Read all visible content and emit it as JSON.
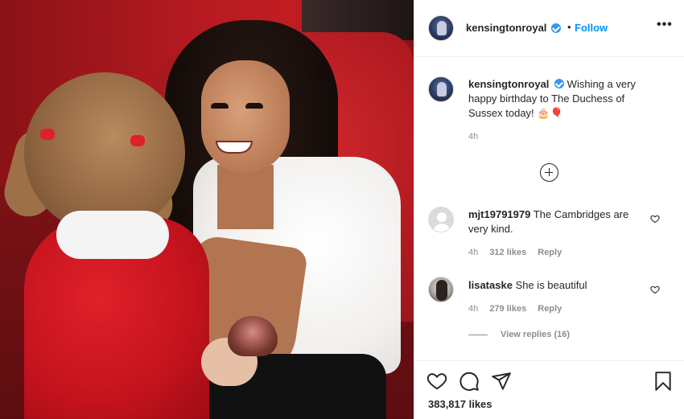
{
  "post": {
    "username": "kensingtonroyal",
    "separator": "•",
    "follow_label": "Follow",
    "more_label": "•••"
  },
  "caption": {
    "username": "kensingtonroyal",
    "text": "Wishing a very happy birthday to The Duchess of Sussex today! 🎂🎈",
    "time": "4h"
  },
  "comments": [
    {
      "username": "mjt19791979",
      "text": "The Cambridges are very kind.",
      "time": "4h",
      "likes": "312 likes",
      "reply_label": "Reply",
      "avatar": "default-avatar"
    },
    {
      "username": "lisataske",
      "text": "She is beautiful",
      "time": "4h",
      "likes": "279 likes",
      "reply_label": "Reply",
      "avatar": "photo-avatar"
    }
  ],
  "view_replies": "View replies (16)",
  "likes_count": "383,817 likes",
  "icons": {
    "verified": "verified-badge-icon",
    "load_more": "plus-circle-icon",
    "like": "heart-icon",
    "comment": "comment-bubble-icon",
    "share": "paper-plane-icon",
    "save": "bookmark-icon"
  },
  "colors": {
    "accent": "#0095f6",
    "verified": "#3897f0",
    "muted": "#8e8e8e",
    "text": "#262626",
    "border": "#efefef"
  }
}
